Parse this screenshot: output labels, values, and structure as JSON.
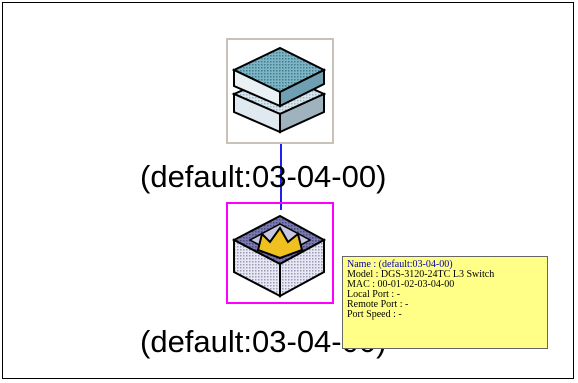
{
  "devices": [
    {
      "label": "(default:03-04-00)",
      "icon": "layer2-switch-stack-icon",
      "selected": false
    },
    {
      "label": "(default:03-04-00)",
      "icon": "layer3-switch-crown-icon",
      "selected": true
    }
  ],
  "tooltip": {
    "name": "Name   : (default:03-04-00)",
    "model": "Model  : DGS-3120-24TC L3 Switch",
    "mac": "MAC    : 00-01-02-03-04-00",
    "local_port": "Local Port : -",
    "remote_port": "Remote Port : -",
    "port_speed": "Port Speed : -"
  },
  "colors": {
    "link": "#2020ee",
    "selection": "#ff00ff",
    "tooltip_bg": "#ffff88",
    "crown": "#f0c020"
  }
}
